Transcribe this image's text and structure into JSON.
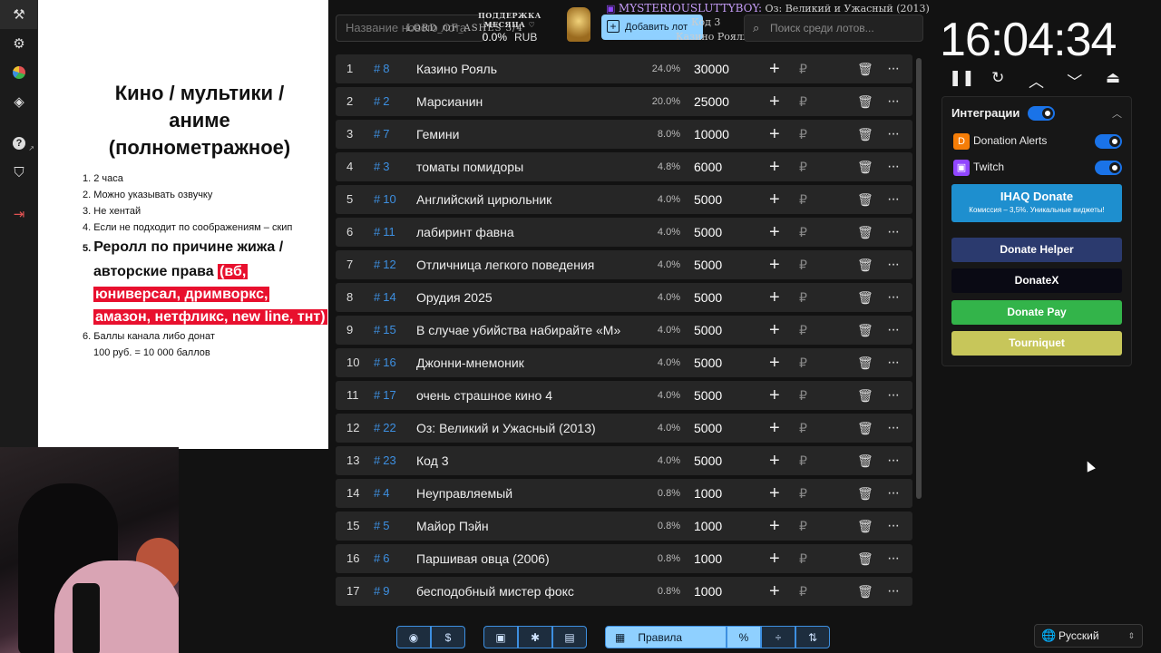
{
  "rail": {
    "items": [
      {
        "icon": "hammer-icon",
        "glyph": "⚒"
      },
      {
        "icon": "gear-icon",
        "glyph": "⚙"
      },
      {
        "icon": "pie-chart-icon",
        "glyph": "◕"
      },
      {
        "icon": "layers-icon",
        "glyph": "◈"
      },
      {
        "icon": "help-icon",
        "glyph": "?"
      },
      {
        "icon": "shield-icon",
        "glyph": "⛉"
      },
      {
        "icon": "logout-icon",
        "glyph": "⇥"
      }
    ]
  },
  "rules": {
    "title": "Кино / мультики / аниме (полнометражное)",
    "item1": "2 часа",
    "item2": "Можно указывать озвучку",
    "item3": "Не хентай",
    "item4": "Если не подходит по соображениям – скип",
    "item5_plain": "Реролл по причине жижа / авторские права ",
    "item5_hl1": "(вб,",
    "item5_hl2": "юниверсал, дримворкс,",
    "item5_hl3": "амазон, нетфликс, new line, тнт)",
    "item6": "Баллы канала либо донат",
    "item6_sub": "100 руб. = 10 000 баллов"
  },
  "top": {
    "search_placeholder": "Название нового лота",
    "ticker": "LORD_OF_ASHES 3/4",
    "support_label": "ПОДДЕРЖКА МЕСЯЦА ♡",
    "support_pct": "0.0%",
    "support_cur": "RUB",
    "add_label": "Добавить лот",
    "notif_nick": "MYSTERIOUSLUTTYBOY:",
    "notif_text": "Оз: Великий и Ужасный (2013)",
    "notif2": "Код 3",
    "notif3": "Казино Рояль",
    "search_lots_placeholder": "Поиск среди лотов..."
  },
  "lots": [
    {
      "n": "1",
      "id": "8",
      "name": "Казино Рояль",
      "pct": "24.0%",
      "amount": "30000"
    },
    {
      "n": "2",
      "id": "2",
      "name": "Марсианин",
      "pct": "20.0%",
      "amount": "25000"
    },
    {
      "n": "3",
      "id": "7",
      "name": "Гемини",
      "pct": "8.0%",
      "amount": "10000"
    },
    {
      "n": "4",
      "id": "3",
      "name": "томаты помидоры",
      "pct": "4.8%",
      "amount": "6000"
    },
    {
      "n": "5",
      "id": "10",
      "name": "Английский цирюльник",
      "pct": "4.0%",
      "amount": "5000"
    },
    {
      "n": "6",
      "id": "11",
      "name": "лабиринт фавна",
      "pct": "4.0%",
      "amount": "5000"
    },
    {
      "n": "7",
      "id": "12",
      "name": "Отличница легкого поведения",
      "pct": "4.0%",
      "amount": "5000"
    },
    {
      "n": "8",
      "id": "14",
      "name": "Орудия 2025",
      "pct": "4.0%",
      "amount": "5000"
    },
    {
      "n": "9",
      "id": "15",
      "name": "В случае убийства набирайте «М»",
      "pct": "4.0%",
      "amount": "5000"
    },
    {
      "n": "10",
      "id": "16",
      "name": "Джонни-мнемоник",
      "pct": "4.0%",
      "amount": "5000"
    },
    {
      "n": "11",
      "id": "17",
      "name": "очень страшное кино 4",
      "pct": "4.0%",
      "amount": "5000"
    },
    {
      "n": "12",
      "id": "22",
      "name": "Оз: Великий и Ужасный (2013)",
      "pct": "4.0%",
      "amount": "5000"
    },
    {
      "n": "13",
      "id": "23",
      "name": "Код 3",
      "pct": "4.0%",
      "amount": "5000"
    },
    {
      "n": "14",
      "id": "4",
      "name": "Неуправляемый",
      "pct": "0.8%",
      "amount": "1000"
    },
    {
      "n": "15",
      "id": "5",
      "name": "Майор Пэйн",
      "pct": "0.8%",
      "amount": "1000"
    },
    {
      "n": "16",
      "id": "6",
      "name": "Паршивая овца (2006)",
      "pct": "0.8%",
      "amount": "1000"
    },
    {
      "n": "17",
      "id": "9",
      "name": "бесподобный мистер фокс",
      "pct": "0.8%",
      "amount": "1000"
    }
  ],
  "lot_symbols": {
    "hash": "#",
    "plus": "+",
    "currency": "₽",
    "delete": "🗑",
    "more": "···"
  },
  "toolbar": {
    "github": "◉",
    "donate": "$",
    "save": "▣",
    "bug": "✱",
    "trash": "▤",
    "rules_icon": "▦",
    "rules_label": "Правила",
    "percent": "%",
    "split": "÷",
    "sort": "⇅"
  },
  "timer": {
    "time": "16:04:34",
    "pause": "❚❚",
    "reset": "↻",
    "up": "︿",
    "down": "﹀",
    "max": "⏏"
  },
  "integrations": {
    "title": "Интеграции",
    "chevron": "︿",
    "donation_alerts": "Donation Alerts",
    "twitch": "Twitch",
    "ihaq": "IHAQ Donate",
    "ihaq_sub": "Комиссия – 3,5%. Уникальные виджеты!",
    "donate_helper": "Donate Helper",
    "donatex": "DonateX",
    "donate_pay": "Donate Pay",
    "tourniquet": "Tourniquet"
  },
  "lang": {
    "label": "Русский",
    "globe": "🌐",
    "arrow": "⇕"
  }
}
